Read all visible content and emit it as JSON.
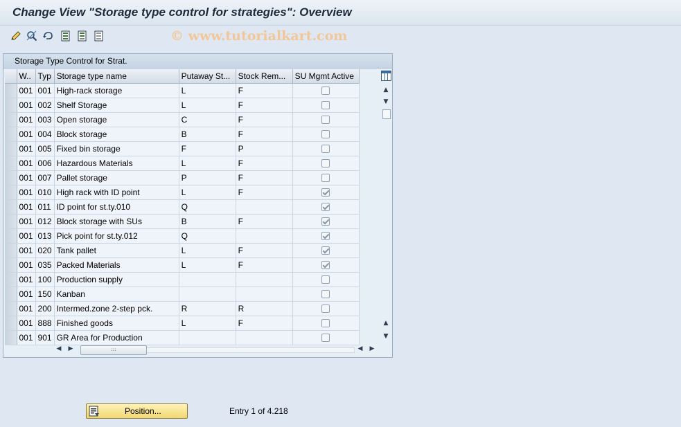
{
  "window": {
    "title": "Change View \"Storage type control for strategies\": Overview"
  },
  "watermark": "© www.tutorialkart.com",
  "toolbar": {
    "icons": [
      "change-display-icon",
      "find-icon",
      "undo-icon",
      "select-all-icon",
      "select-block-icon",
      "deselect-all-icon"
    ]
  },
  "table": {
    "title": "Storage Type Control for Strat.",
    "columns": [
      "W..",
      "Typ",
      "Storage type name",
      "Putaway St...",
      "Stock Rem...",
      "SU Mgmt Active"
    ],
    "rows": [
      {
        "w": "001",
        "typ": "001",
        "name": "High-rack storage",
        "putaway": "L",
        "removal": "F",
        "su": false
      },
      {
        "w": "001",
        "typ": "002",
        "name": "Shelf Storage",
        "putaway": "L",
        "removal": "F",
        "su": false
      },
      {
        "w": "001",
        "typ": "003",
        "name": "Open storage",
        "putaway": "C",
        "removal": "F",
        "su": false
      },
      {
        "w": "001",
        "typ": "004",
        "name": "Block storage",
        "putaway": "B",
        "removal": "F",
        "su": false
      },
      {
        "w": "001",
        "typ": "005",
        "name": "Fixed bin storage",
        "putaway": "F",
        "removal": "P",
        "su": false
      },
      {
        "w": "001",
        "typ": "006",
        "name": "Hazardous Materials",
        "putaway": "L",
        "removal": "F",
        "su": false
      },
      {
        "w": "001",
        "typ": "007",
        "name": "Pallet storage",
        "putaway": "P",
        "removal": "F",
        "su": false
      },
      {
        "w": "001",
        "typ": "010",
        "name": "High rack with ID point",
        "putaway": "L",
        "removal": "F",
        "su": true
      },
      {
        "w": "001",
        "typ": "011",
        "name": "ID point for st.ty.010",
        "putaway": "Q",
        "removal": "",
        "su": true
      },
      {
        "w": "001",
        "typ": "012",
        "name": "Block storage with SUs",
        "putaway": "B",
        "removal": "F",
        "su": true
      },
      {
        "w": "001",
        "typ": "013",
        "name": "Pick point for st.ty.012",
        "putaway": "Q",
        "removal": "",
        "su": true
      },
      {
        "w": "001",
        "typ": "020",
        "name": "Tank pallet",
        "putaway": "L",
        "removal": "F",
        "su": true
      },
      {
        "w": "001",
        "typ": "035",
        "name": "Packed Materials",
        "putaway": "L",
        "removal": "F",
        "su": true
      },
      {
        "w": "001",
        "typ": "100",
        "name": "Production supply",
        "putaway": "",
        "removal": "",
        "su": false
      },
      {
        "w": "001",
        "typ": "150",
        "name": "Kanban",
        "putaway": "",
        "removal": "",
        "su": false
      },
      {
        "w": "001",
        "typ": "200",
        "name": "Intermed.zone 2-step pck.",
        "putaway": "R",
        "removal": "R",
        "su": false
      },
      {
        "w": "001",
        "typ": "888",
        "name": "Finished goods",
        "putaway": "L",
        "removal": "F",
        "su": false
      },
      {
        "w": "001",
        "typ": "901",
        "name": "GR Area for Production",
        "putaway": "",
        "removal": "",
        "su": false
      }
    ]
  },
  "footer": {
    "position_label": "Position...",
    "entry_text": "Entry 1 of 4.218"
  }
}
